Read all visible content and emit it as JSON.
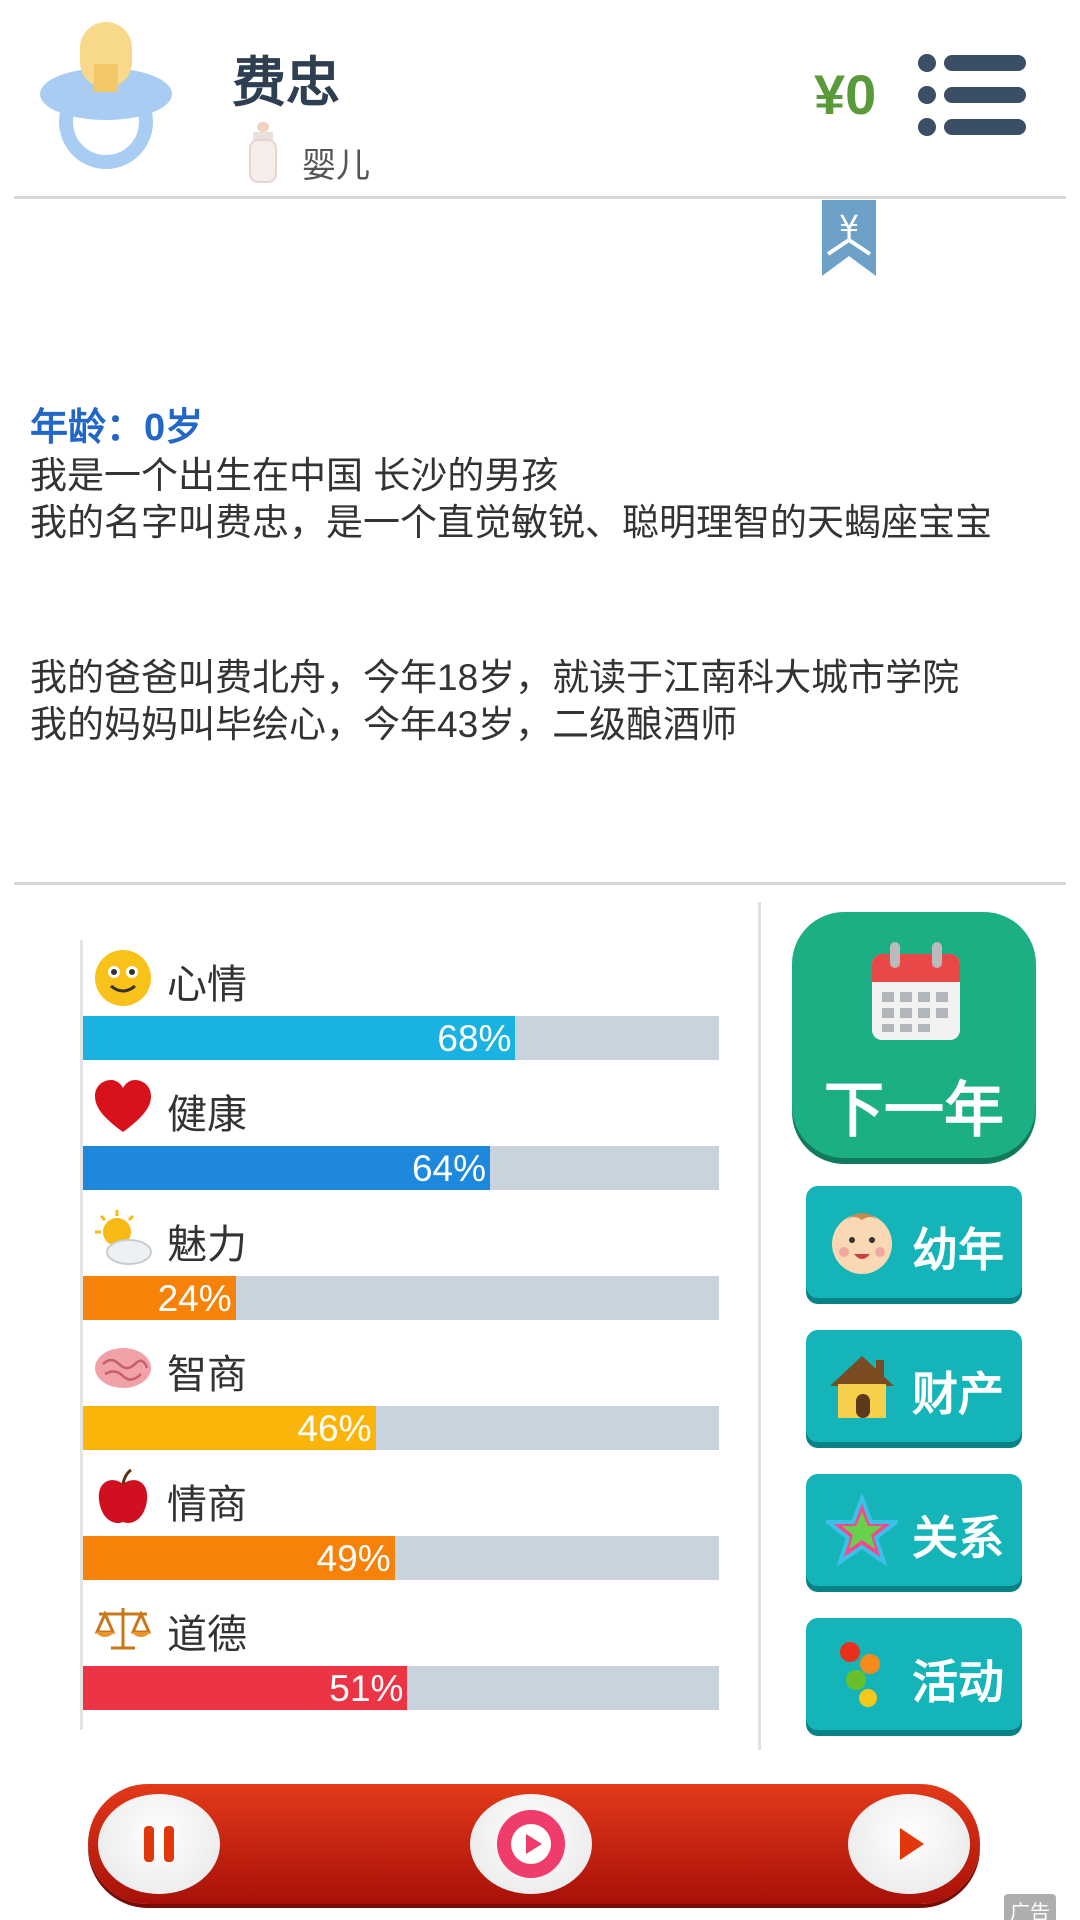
{
  "header": {
    "name": "费忠",
    "stage": "婴儿",
    "money": "¥0"
  },
  "bookmark_symbol": "¥",
  "story": {
    "age_line": "年龄：0岁",
    "line1": "我是一个出生在中国 长沙的男孩",
    "line2": "我的名字叫费忠，是一个直觉敏锐、聪明理智的天蝎座宝宝",
    "line3": "我的爸爸叫费北舟，今年18岁，就读于江南科大城市学院",
    "line4": "我的妈妈叫毕绘心，今年43岁，二级酿酒师"
  },
  "stats": [
    {
      "label": "心情",
      "pct_text": "68%",
      "value": 68,
      "color": "#1ab2e0",
      "icon": "smiley-icon"
    },
    {
      "label": "健康",
      "pct_text": "64%",
      "value": 64,
      "color": "#1e88dc",
      "icon": "heart-icon"
    },
    {
      "label": "魅力",
      "pct_text": "24%",
      "value": 24,
      "color": "#f7820a",
      "icon": "sun-cloud-icon"
    },
    {
      "label": "智商",
      "pct_text": "46%",
      "value": 46,
      "color": "#fbb40a",
      "icon": "brain-icon"
    },
    {
      "label": "情商",
      "pct_text": "49%",
      "value": 49,
      "color": "#f7820a",
      "icon": "apple-icon"
    },
    {
      "label": "道德",
      "pct_text": "51%",
      "value": 51,
      "color": "#ec3444",
      "icon": "scales-icon"
    }
  ],
  "buttons": {
    "next_year": "下一年",
    "childhood": "幼年",
    "property": "财产",
    "relations": "关系",
    "activity": "活动"
  },
  "ad_label": "广告",
  "colors": {
    "accent_green": "#1caf83",
    "teal_button": "#14b4b8",
    "money_green": "#5a9a3a",
    "age_blue": "#2266c8",
    "player_red": "#d02a12"
  }
}
